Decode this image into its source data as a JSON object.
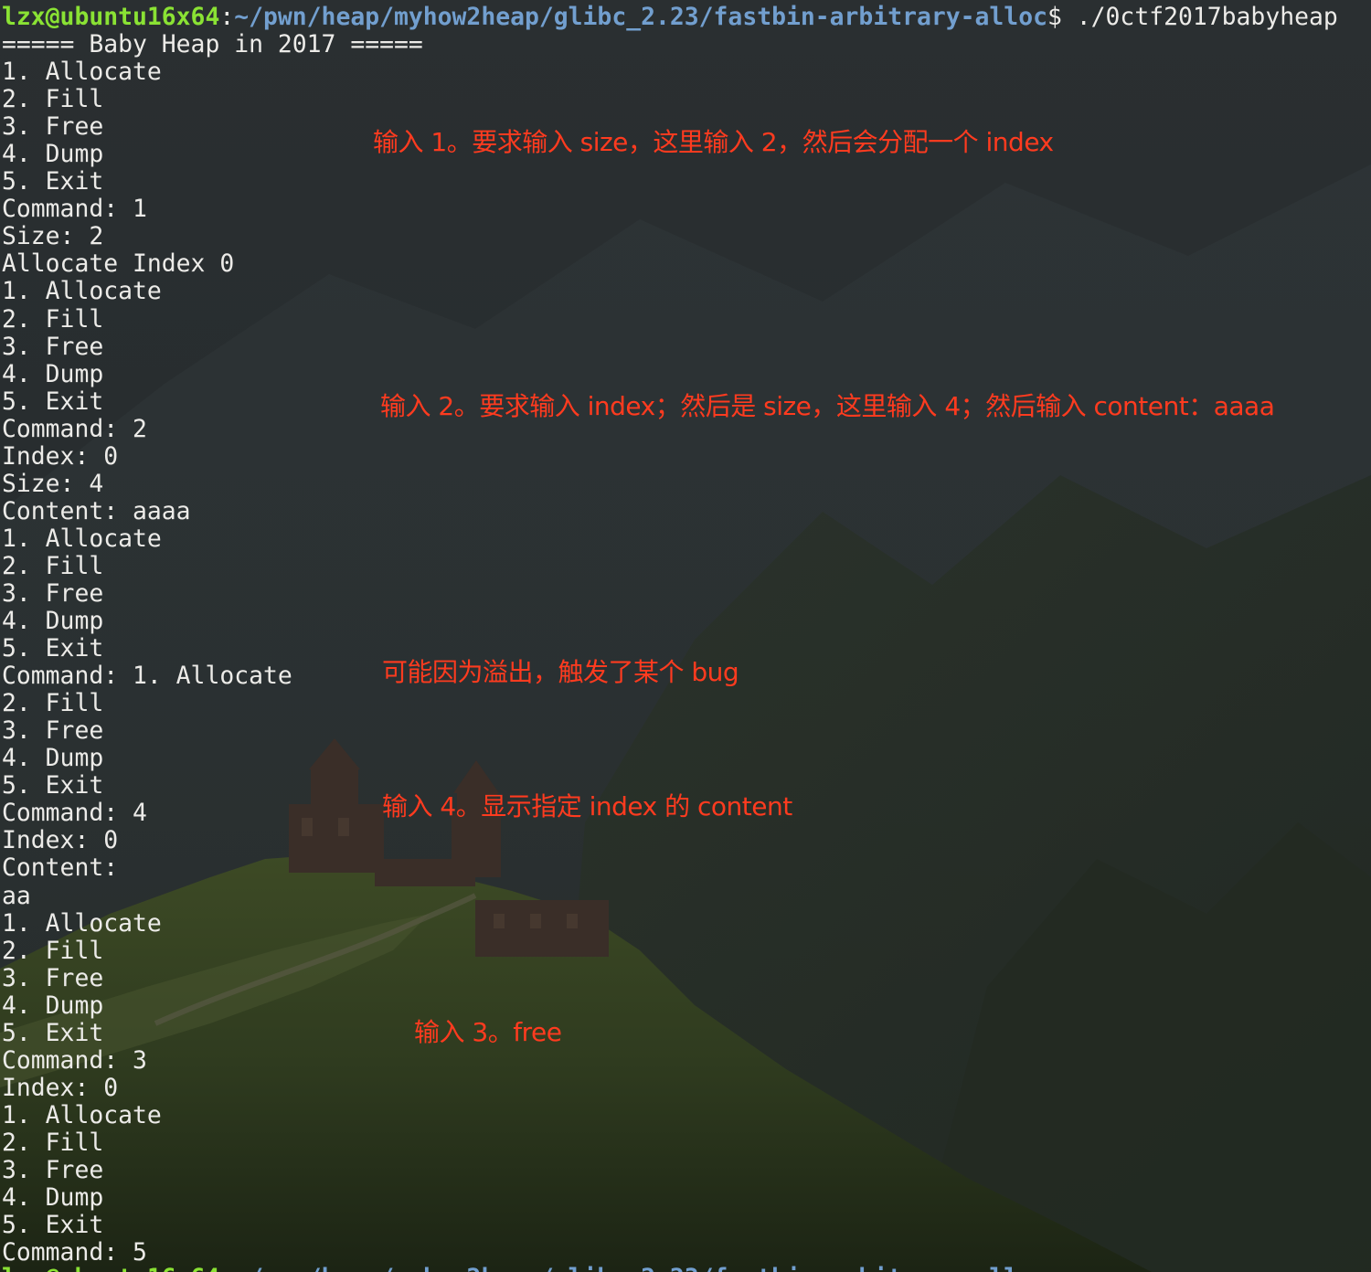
{
  "prompt": {
    "user_host": "lzx@ubuntu16x64",
    "separator": ":",
    "path": "~/pwn/heap/myhow2heap/glibc_2.23/fastbin-arbitrary-alloc",
    "symbol": "$ ",
    "command": "./0ctf2017babyheap"
  },
  "output_lines": [
    "===== Baby Heap in 2017 =====",
    "1. Allocate",
    "2. Fill",
    "3. Free",
    "4. Dump",
    "5. Exit",
    "Command: 1",
    "Size: 2",
    "Allocate Index 0",
    "1. Allocate",
    "2. Fill",
    "3. Free",
    "4. Dump",
    "5. Exit",
    "Command: 2",
    "Index: 0",
    "Size: 4",
    "Content: aaaa",
    "1. Allocate",
    "2. Fill",
    "3. Free",
    "4. Dump",
    "5. Exit",
    "Command: 1. Allocate",
    "2. Fill",
    "3. Free",
    "4. Dump",
    "5. Exit",
    "Command: 4",
    "Index: 0",
    "Content: ",
    "aa",
    "1. Allocate",
    "2. Fill",
    "3. Free",
    "4. Dump",
    "5. Exit",
    "Command: 3",
    "Index: 0",
    "1. Allocate",
    "2. Fill",
    "3. Free",
    "4. Dump",
    "5. Exit",
    "Command: 5"
  ],
  "annotations": [
    "输入 1。要求输入 size，这里输入 2，然后会分配一个 index",
    "输入 2。要求输入 index；然后是 size，这里输入 4；然后输入 content：aaaa",
    "可能因为溢出，触发了某个 bug",
    "输入 4。显示指定 index 的 content",
    "输入 3。free"
  ],
  "colors": {
    "text": "#ecebe8",
    "prompt_user": "#8ae234",
    "prompt_path": "#729fcf",
    "annotation": "#ff3b1f",
    "background": "#272b2d"
  }
}
